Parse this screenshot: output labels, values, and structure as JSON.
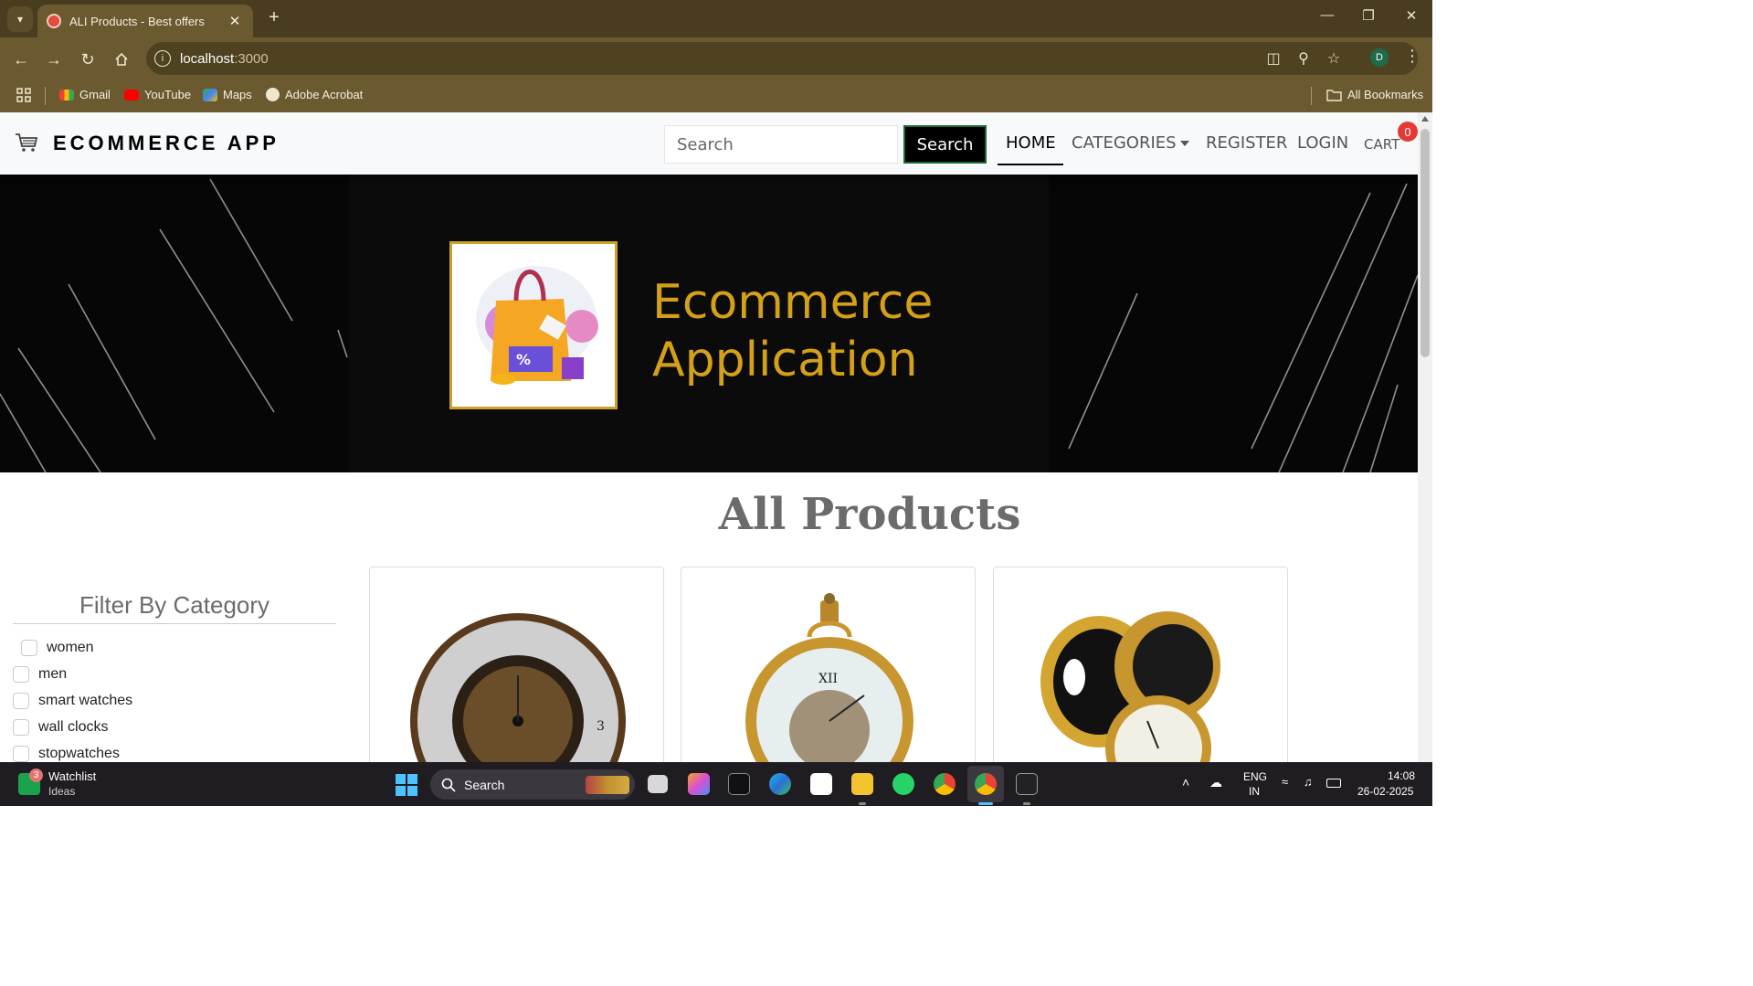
{
  "browser": {
    "tab_title": "ALI Products - Best offers",
    "url_host": "localhost",
    "url_port": ":3000",
    "profile_initial": "D",
    "bookmarks": [
      "Gmail",
      "YouTube",
      "Maps",
      "Adobe Acrobat"
    ],
    "all_bookmarks_label": "All Bookmarks"
  },
  "navbar": {
    "brand": "ECOMMERCE APP",
    "search_placeholder": "Search",
    "search_button": "Search",
    "links": {
      "home": "HOME",
      "categories": "CATEGORIES",
      "register": "REGISTER",
      "login": "LOGIN",
      "cart": "CART"
    },
    "cart_count": "0"
  },
  "banner": {
    "line1": "Ecommerce",
    "line2": "Application",
    "text_color": "#d4a017"
  },
  "main": {
    "title": "All Products",
    "filter_title": "Filter By Category",
    "categories": [
      "women",
      "men",
      "smart watches",
      "wall clocks",
      "stopwatches"
    ]
  },
  "taskbar": {
    "widget_title": "Watchlist",
    "widget_subtitle": "Ideas",
    "widget_badge": "3",
    "search_label": "Search",
    "lang_line1": "ENG",
    "lang_line2": "IN",
    "time": "14:08",
    "date": "26-02-2025"
  }
}
